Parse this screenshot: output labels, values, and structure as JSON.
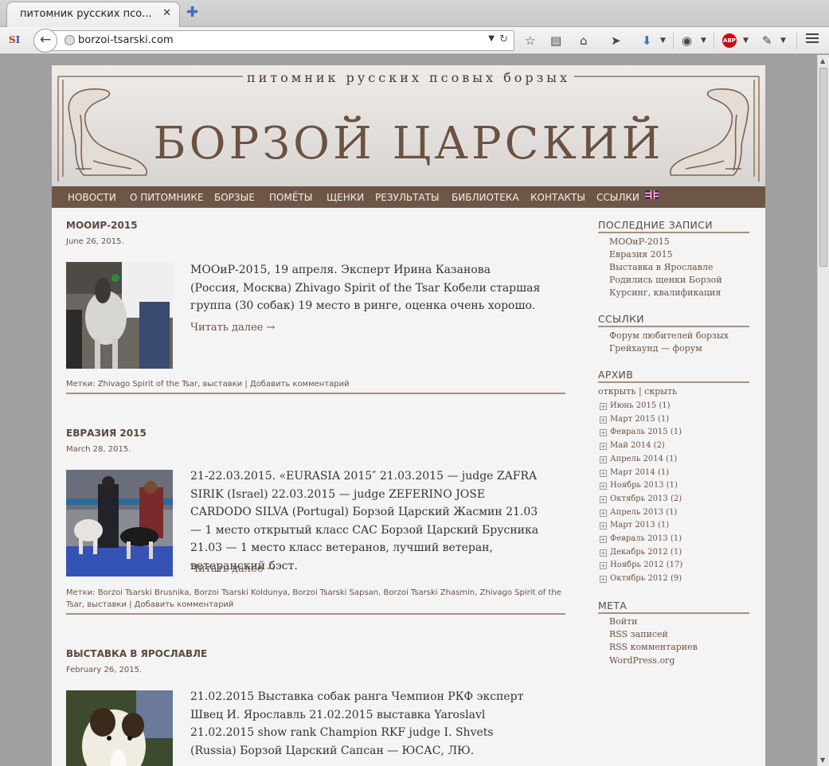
{
  "browser": {
    "tab_title": "питомник русских псо...",
    "tab_close": "✕",
    "new_tab": "✚",
    "url": "borzoi-tsarski.com",
    "back": "←",
    "url_dropdown": "▼",
    "url_reload": "↻",
    "icons": [
      "bookmark-star-icon",
      "reading-list-icon",
      "home-icon",
      "send-icon",
      "download-icon",
      "privacy-icon",
      "adblock-plus-icon",
      "extension-icon",
      "menu-icon"
    ]
  },
  "site": {
    "tagline": "питомник русских псовых борзых",
    "title": "БОРЗОЙ ЦАРСКИЙ"
  },
  "nav": [
    "НОВОСТИ",
    "О ПИТОМНИКЕ",
    "БОРЗЫЕ",
    "ПОМЁТЫ",
    "ЩЕНКИ",
    "РЕЗУЛЬТАТЫ",
    "БИБЛИОТЕКА",
    "КОНТАКТЫ",
    "ССЫЛКИ"
  ],
  "posts": [
    {
      "title": "МООИР-2015",
      "date": "June 26, 2015.",
      "text": "МООиР-2015, 19 апреля. Эксперт Ирина Казанова (Россия, Москва) Zhivago Spirit of the Tsar Кобели старшая группа (30 собак) 19 место в ринге, оценка очень хорошо.",
      "read_more": "Читать далее →",
      "meta": "Метки: Zhivago Spirit of the Tsar, выставки | Добавить комментарий"
    },
    {
      "title": "ЕВРАЗИЯ 2015",
      "date": "March 28, 2015.",
      "text": "21-22.03.2015. «EURASIA 2015″ 21.03.2015 — judge ZAFRA SIRIK (Israel) 22.03.2015 — judge ZEFERINO JOSE CARDODO SILVA (Portugal) Борзой Царский Жасмин 21.03 — 1 место открытый класс CAC Борзой Царский Брусника 21.03 — 1 место класс ветеранов, лучший ветеран, ветеранский бэст.",
      "read_more": "Читать далее →",
      "meta": "Метки: Borzoi Tsarski Brusnika, Borzoi Tsarski Koldunya, Borzoi Tsarski Sapsan, Borzoi Tsarski Zhasmin, Zhivago Spirit of the Tsar, выставки | Добавить комментарий"
    },
    {
      "title": "ВЫСТАВКА В ЯРОСЛАВЛЕ",
      "date": "February 26, 2015.",
      "text": "21.02.2015 Выставка собак ранга Чемпион РКФ эксперт Швец И. Ярославль 21.02.2015 выставка Yaroslavl 21.02.2015 show rank Champion RKF judge I. Shvets (Russia) Борзой Царский Сапсан — ЮСАС, ЛЮ."
    }
  ],
  "sidebar": {
    "recent": {
      "heading": "ПОСЛЕДНИЕ ЗАПИСИ",
      "items": [
        "МООиР-2015",
        "Евразия 2015",
        "Выставка в Ярославле",
        "Родились щенки Борзой",
        "Курсинг, квалификация"
      ]
    },
    "links": {
      "heading": "ССЫЛКИ",
      "items": [
        "Форум любителей борзых",
        "Грейхаунд — форум"
      ]
    },
    "archive": {
      "heading": "АРХИВ",
      "toggle": "открыть | скрыть",
      "items": [
        "Июнь 2015 (1)",
        "Март 2015 (1)",
        "Февраль 2015 (1)",
        "Май 2014 (2)",
        "Апрель 2014 (1)",
        "Март 2014 (1)",
        "Ноябрь 2013 (1)",
        "Октябрь 2013 (2)",
        "Апрель 2013 (1)",
        "Март 2013 (1)",
        "Февраль 2013 (1)",
        "Декабрь 2012 (1)",
        "Ноябрь 2012 (17)",
        "Октябрь 2012 (9)"
      ]
    },
    "meta": {
      "heading": "МЕТА",
      "items": [
        "Войти",
        "RSS записей",
        "RSS комментариев",
        "WordPress.org"
      ]
    }
  }
}
